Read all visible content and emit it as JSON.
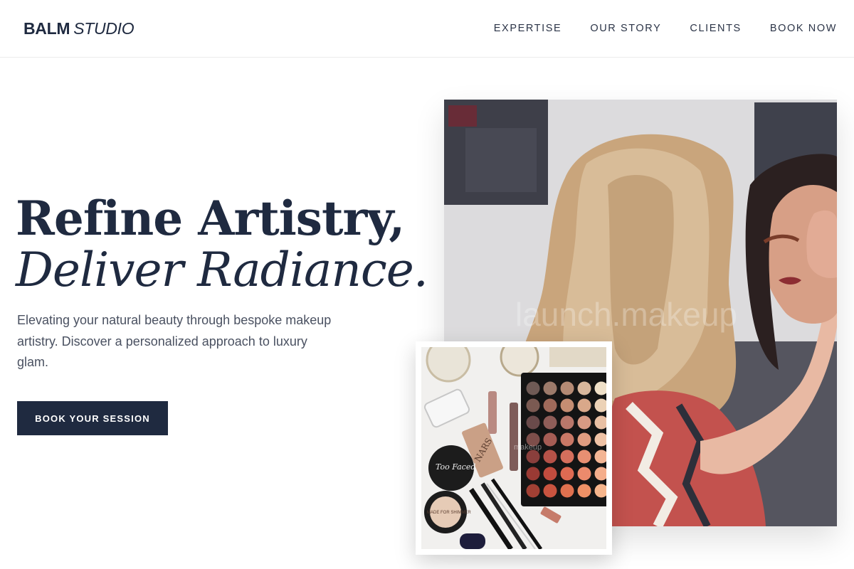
{
  "brand": {
    "bold": "BALM",
    "italic": "STUDIO"
  },
  "nav": [
    {
      "label": "EXPERTISE"
    },
    {
      "label": "OUR STORY"
    },
    {
      "label": "CLIENTS"
    },
    {
      "label": "BOOK NOW"
    }
  ],
  "hero": {
    "title_line1": "Refine Artistry,",
    "title_line2": "Deliver Radiance.",
    "description": "Elevating your natural beauty through bespoke makeup artistry. Discover a personalized approach to luxury glam.",
    "cta_label": "BOOK YOUR SESSION"
  },
  "images": {
    "main": {
      "watermark": "launch.makeup"
    },
    "inset": {
      "watermark": "makeup",
      "product_labels": [
        "Too Faced",
        "NARS",
        "MADE FOR SHIMMER"
      ]
    }
  },
  "colors": {
    "navy": "#1f2a40",
    "text_gray": "#4a5161",
    "background": "#ffffff"
  }
}
